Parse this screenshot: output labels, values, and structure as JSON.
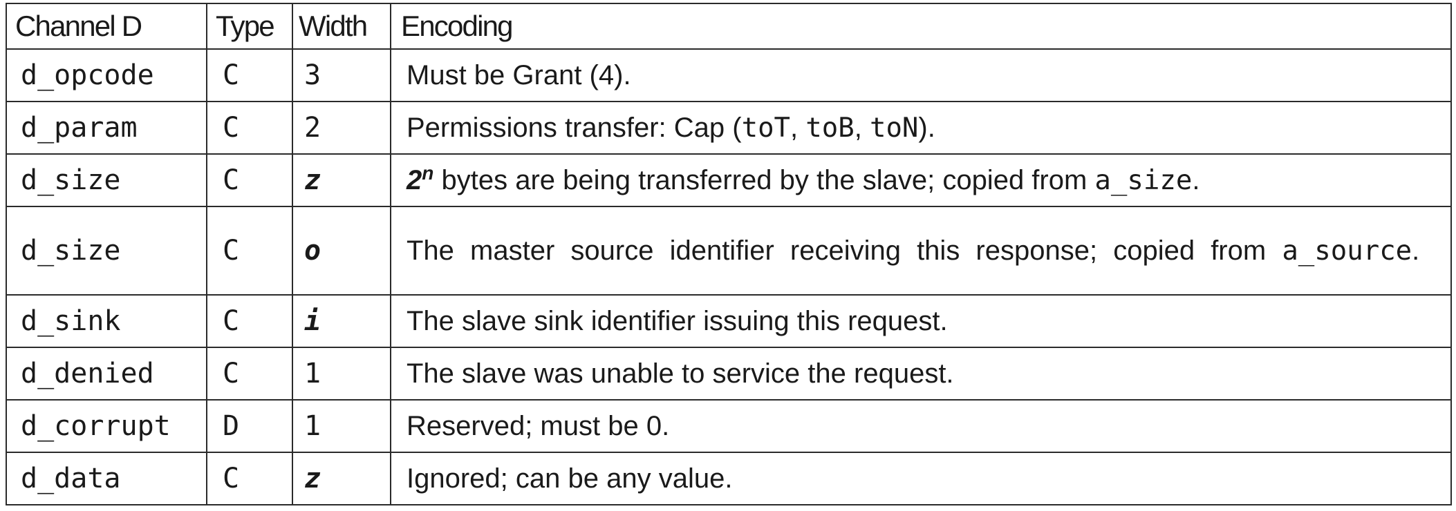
{
  "table": {
    "headers": [
      "Channel D",
      "Type",
      "Width",
      "Encoding"
    ],
    "rows": [
      {
        "name": "d_opcode",
        "type": "C",
        "width": "3",
        "encoding": "Must be Grant (4)."
      },
      {
        "name": "d_param",
        "type": "C",
        "width": "2",
        "encoding_prefix": "Permissions transfer: Cap (",
        "encoding_code1": "toT",
        "encoding_sep1": ", ",
        "encoding_code2": "toB",
        "encoding_sep2": ", ",
        "encoding_code3": "toN",
        "encoding_suffix": ")."
      },
      {
        "name": "d_size",
        "type": "C",
        "width": "z",
        "encoding_base": "2",
        "encoding_exp": "n",
        "encoding_text": " bytes are being transferred by the slave; copied from ",
        "encoding_code": "a_size",
        "encoding_end": "."
      },
      {
        "name": "d_size",
        "type": "C",
        "width": "o",
        "encoding_text": "The master source identifier receiving this response; copied from ",
        "encoding_code": "a_source",
        "encoding_end": "."
      },
      {
        "name": "d_sink",
        "type": "C",
        "width": "i",
        "encoding": "The slave sink identifier issuing this request."
      },
      {
        "name": "d_denied",
        "type": "C",
        "width": "1",
        "encoding": "The slave was unable to service the request."
      },
      {
        "name": "d_corrupt",
        "type": "D",
        "width": "1",
        "encoding": "Reserved; must be 0."
      },
      {
        "name": "d_data",
        "type": "C",
        "width": "z",
        "encoding": "Ignored; can be any value."
      }
    ]
  }
}
